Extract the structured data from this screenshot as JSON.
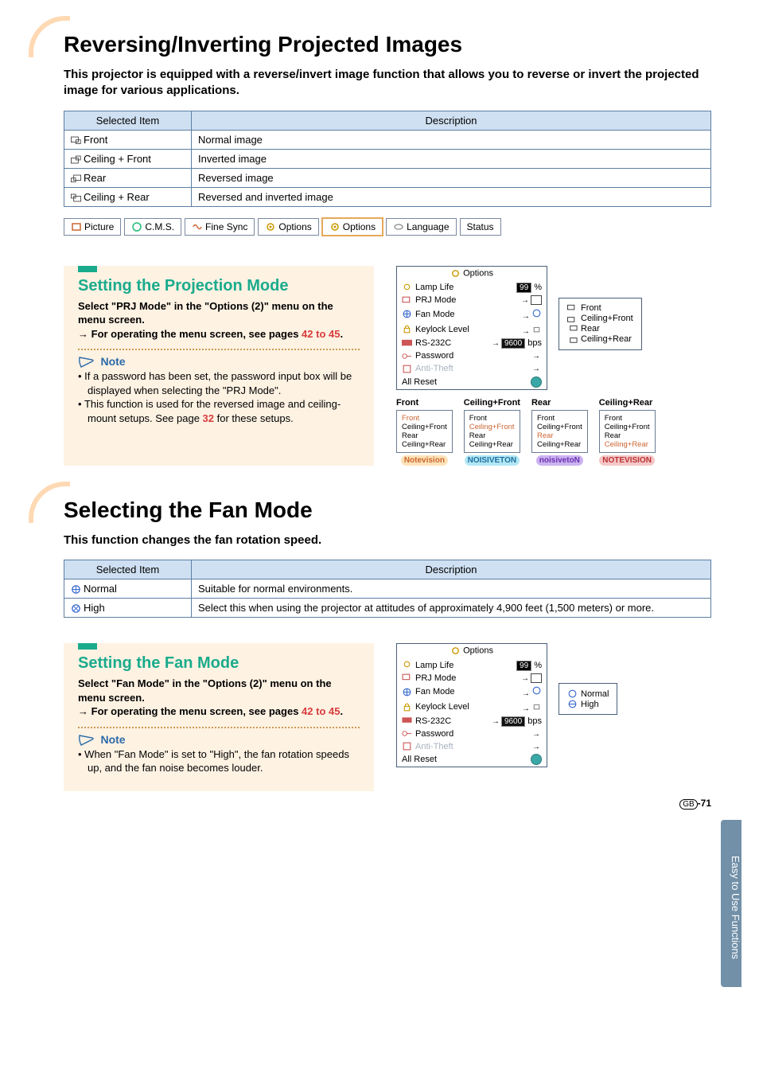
{
  "section1": {
    "title": "Reversing/Inverting Projected Images",
    "intro": "This projector is equipped with a reverse/invert image function that allows you to reverse or invert the projected image for various applications.",
    "table": {
      "col1": "Selected Item",
      "col2": "Description",
      "rows": [
        {
          "item": "Front",
          "desc": "Normal image"
        },
        {
          "item": "Ceiling + Front",
          "desc": "Inverted image"
        },
        {
          "item": "Rear",
          "desc": "Reversed image"
        },
        {
          "item": "Ceiling + Rear",
          "desc": "Reversed and inverted image"
        }
      ]
    }
  },
  "tabs": [
    "Picture",
    "C.M.S.",
    "Fine Sync",
    "Options",
    "Options",
    "Language",
    "Status"
  ],
  "sub1": {
    "heading": "Setting the Projection Mode",
    "p1": "Select \"PRJ Mode\" in the \"Options (2)\" menu on the menu screen.",
    "p2": "For operating the menu screen, see pages ",
    "page_ref": "42 to 45",
    "note_label": "Note",
    "note1": "If a password has been set, the password input box will be displayed when selecting the \"PRJ Mode\".",
    "note2a": "This function is used for the reversed image and ceiling-mount setups. See page ",
    "note2_ref": "32",
    "note2b": " for these setups."
  },
  "osd1": {
    "title": "Options",
    "rows": [
      {
        "label": "Lamp Life",
        "value": "99",
        "suffix": "%"
      },
      {
        "label": "PRJ Mode",
        "arrow": true,
        "icon": "prj"
      },
      {
        "label": "Fan Mode",
        "arrow": true,
        "icon": "fan"
      },
      {
        "label": "Keylock Level",
        "arrow": true,
        "icon": "lock"
      },
      {
        "label": "RS-232C",
        "arrow": true,
        "value": "9600",
        "suffix": "bps"
      },
      {
        "label": "Password",
        "arrow": true
      },
      {
        "label": "Anti-Theft",
        "arrow": true,
        "dim": true
      },
      {
        "label": "All Reset",
        "btn": true
      }
    ],
    "popup": [
      "Front",
      "Ceiling+Front",
      "Rear",
      "Ceiling+Rear"
    ]
  },
  "thumbs": {
    "titles": [
      "Front",
      "Ceiling+Front",
      "Rear",
      "Ceiling+Rear"
    ],
    "opts": [
      "Front",
      "Ceiling+Front",
      "Rear",
      "Ceiling+Rear"
    ],
    "logos": [
      "Notevision",
      "NOISIVETON",
      "noisivetoN",
      "NOTEVISION"
    ]
  },
  "section2": {
    "title": "Selecting the Fan Mode",
    "intro": "This function changes the fan rotation speed.",
    "table": {
      "col1": "Selected Item",
      "col2": "Description",
      "rows": [
        {
          "item": "Normal",
          "desc": "Suitable for normal environments."
        },
        {
          "item": "High",
          "desc": "Select this when using the projector at attitudes of approximately 4,900 feet (1,500 meters) or more."
        }
      ]
    }
  },
  "sub2": {
    "heading": "Setting the Fan Mode",
    "p1": "Select \"Fan Mode\" in the \"Options (2)\" menu on the menu screen.",
    "p2": "For operating the menu screen, see pages ",
    "page_ref": "42 to 45",
    "note_label": "Note",
    "note1": "When \"Fan Mode\" is set to \"High\", the fan rotation speeds up, and the fan noise becomes louder."
  },
  "osd2": {
    "popup": [
      "Normal",
      "High"
    ]
  },
  "side_tab": "Easy to Use Functions",
  "page_number": "-71",
  "page_prefix": "GB"
}
